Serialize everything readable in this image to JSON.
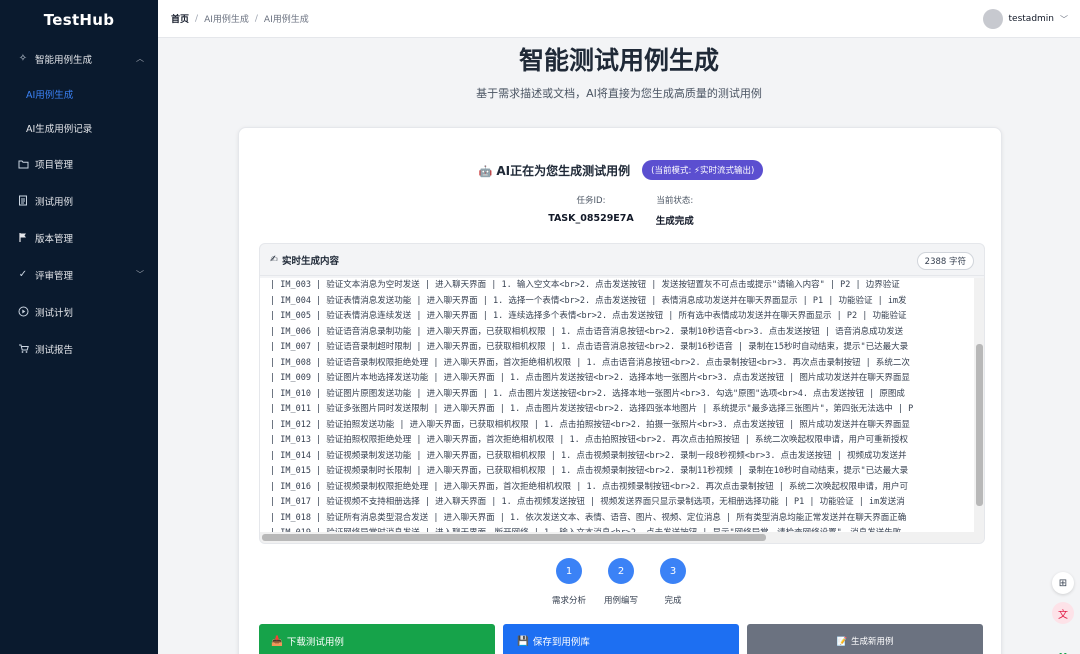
{
  "app": {
    "name": "TestHub"
  },
  "sidebar": {
    "group": {
      "label": "智能用例生成",
      "icon": "sparkle-icon"
    },
    "subitems": [
      {
        "label": "AI用例生成",
        "active": true
      },
      {
        "label": "AI生成用例记录",
        "active": false
      }
    ],
    "items": [
      {
        "label": "项目管理",
        "icon": "folder-icon"
      },
      {
        "label": "测试用例",
        "icon": "document-icon"
      },
      {
        "label": "版本管理",
        "icon": "flag-icon"
      },
      {
        "label": "评审管理",
        "icon": "check-icon"
      },
      {
        "label": "测试计划",
        "icon": "play-circle-icon"
      },
      {
        "label": "测试报告",
        "icon": "cart-icon"
      }
    ]
  },
  "header": {
    "breadcrumb": [
      "首页",
      "AI用例生成",
      "AI用例生成"
    ],
    "username": "testadmin"
  },
  "main": {
    "title": "智能测试用例生成",
    "subtitle": "基于需求描述或文档，AI将直接为您生成高质量的测试用例",
    "gen_title": "AI正在为您生成测试用例",
    "mode_badge": "(当前模式: ⚡实时流式输出)",
    "task_id_label": "任务ID:",
    "task_id": "TASK_08529E7A",
    "status_label": "当前状态:",
    "status": "生成完成",
    "stream_title": "实时生成内容",
    "char_count": "2388 字符",
    "stream_lines": [
      "| IM_003 | 验证文本消息为空时发送 | 进入聊天界面 | 1. 输入空文本<br>2. 点击发送按钮 | 发送按钮置灰不可点击或提示\"请输入内容\" | P2 | 边界验证",
      "| IM_004 | 验证表情消息发送功能 | 进入聊天界面 | 1. 选择一个表情<br>2. 点击发送按钮 | 表情消息成功发送并在聊天界面显示 | P1 | 功能验证 | im发",
      "| IM_005 | 验证表情消息连续发送 | 进入聊天界面 | 1. 连续选择多个表情<br>2. 点击发送按钮 | 所有选中表情成功发送并在聊天界面显示 | P2 | 功能验证",
      "| IM_006 | 验证语音消息录制功能 | 进入聊天界面，已获取相机权限 | 1. 点击语音消息按钮<br>2. 录制10秒语音<br>3. 点击发送按钮 | 语音消息成功发送",
      "| IM_007 | 验证语音录制超时限制 | 进入聊天界面，已获取相机权限 | 1. 点击语音消息按钮<br>2. 录制16秒语音 | 录制在15秒时自动结束，提示\"已达最大录",
      "| IM_008 | 验证语音录制权限拒绝处理 | 进入聊天界面，首次拒绝相机权限 | 1. 点击语音消息按钮<br>2. 点击录制按钮<br>3. 再次点击录制按钮 | 系统二次",
      "| IM_009 | 验证图片本地选择发送功能 | 进入聊天界面 | 1. 点击图片发送按钮<br>2. 选择本地一张图片<br>3. 点击发送按钮 | 图片成功发送并在聊天界面显",
      "| IM_010 | 验证图片原图发送功能 | 进入聊天界面 | 1. 点击图片发送按钮<br>2. 选择本地一张图片<br>3. 勾选\"原图\"选项<br>4. 点击发送按钮 | 原图成",
      "| IM_011 | 验证多张图片同时发送限制 | 进入聊天界面 | 1. 点击图片发送按钮<br>2. 选择四张本地图片 | 系统提示\"最多选择三张图片\"，第四张无法选中 | P",
      "| IM_012 | 验证拍照发送功能 | 进入聊天界面，已获取相机权限 | 1. 点击拍照按钮<br>2. 拍摄一张照片<br>3. 点击发送按钮 | 照片成功发送并在聊天界面显",
      "| IM_013 | 验证拍照权限拒绝处理 | 进入聊天界面，首次拒绝相机权限 | 1. 点击拍照按钮<br>2. 再次点击拍照按钮 | 系统二次唤起权限申请，用户可重新授权",
      "| IM_014 | 验证视频录制发送功能 | 进入聊天界面，已获取相机权限 | 1. 点击视频录制按钮<br>2. 录制一段8秒视频<br>3. 点击发送按钮 | 视频成功发送并",
      "| IM_015 | 验证视频录制时长限制 | 进入聊天界面，已获取相机权限 | 1. 点击视频录制按钮<br>2. 录制11秒视频 | 录制在10秒时自动结束，提示\"已达最大录",
      "| IM_016 | 验证视频录制权限拒绝处理 | 进入聊天界面，首次拒绝相机权限 | 1. 点击视频录制按钮<br>2. 再次点击录制按钮 | 系统二次唤起权限申请，用户可",
      "| IM_017 | 验证视频不支持相册选择 | 进入聊天界面 | 1. 点击视频发送按钮 | 视频发送界面只显示录制选项，无相册选择功能 | P1 | 功能验证 | im发送消",
      "| IM_018 | 验证所有消息类型混合发送 | 进入聊天界面 | 1. 依次发送文本、表情、语音、图片、视频、定位消息 | 所有类型消息均能正常发送并在聊天界面正确",
      "| IM_019 | 验证网络异常时消息发送 | 进入聊天界面，断开网络 | 1. 输入文本消息<br>2. 点击发送按钮 | 显示\"网络异常，请检查网络设置\"，消息发送失败"
    ],
    "steps": [
      {
        "num": "1",
        "label": "需求分析"
      },
      {
        "num": "2",
        "label": "用例编写"
      },
      {
        "num": "3",
        "label": "完成"
      }
    ],
    "actions": {
      "download": "下载测试用例",
      "save": "保存到用例库",
      "new": "生成新用例"
    }
  },
  "colors": {
    "sidebar_bg": "#0a1a2e",
    "accent": "#3b82f6",
    "badge": "#5b4fd0",
    "btn_green": "#16a34a",
    "btn_blue": "#1d6ff2",
    "btn_gray": "#6b7280"
  }
}
